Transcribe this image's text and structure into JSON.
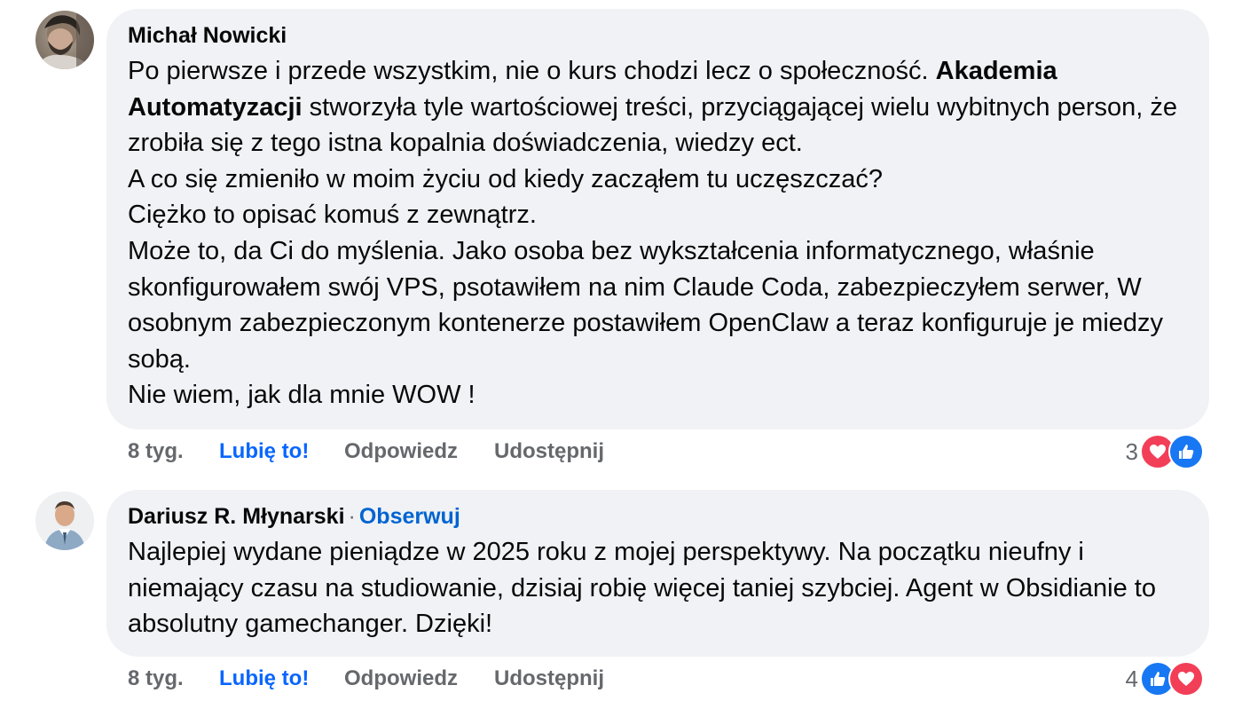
{
  "comments": [
    {
      "author": "Michał Nowicki",
      "avatar": "profile-photo",
      "body_lines": [
        [
          "Po pierwsze i przede wszystkim, nie o kurs chodzi lecz o społeczność. ",
          "Akademia Automatyzacji",
          " stworzyła tyle wartościowej treści, przyciągającej wielu wybitnych person, że zrobiła się z tego istna kopalnia doświadczenia, wiedzy ect."
        ],
        "A co się zmieniło w moim życiu od kiedy zacząłem tu uczęszczać?",
        "Ciężko to opisać komuś z zewnątrz.",
        "Może to, da Ci do myślenia. Jako osoba bez wykształcenia informatycznego, właśnie skonfigurowałem swój VPS, psotawiłem na nim Claude Coda, zabezpieczyłem serwer, W osobnym zabezpieczonym kontenerze postawiłem OpenClaw a teraz konfiguruje je miedzy sobą.",
        "Nie wiem, jak dla mnie WOW !"
      ],
      "bold_phrase": "Akademia Automatyzacji",
      "time": "8 tyg.",
      "like_label": "Lubię to!",
      "reply_label": "Odpowiedz",
      "share_label": "Udostępnij",
      "reaction_count": "3",
      "reaction_icons": [
        "heart-icon",
        "thumbs-up-icon"
      ]
    },
    {
      "author": "Dariusz R. Młynarski",
      "separator": "·",
      "follow_label": "Obserwuj",
      "avatar": "profile-photo",
      "body": "Najlepiej wydane pieniądze w 2025 roku z mojej perspektywy. Na początku nieufny i niemający czasu na studiowanie, dzisiaj robię więcej taniej szybciej. Agent w Obsidianie to absolutny gamechanger. Dzięki!",
      "time": "8 tyg.",
      "like_label": "Lubię to!",
      "reply_label": "Odpowiedz",
      "share_label": "Udostępnij",
      "reaction_count": "4",
      "reaction_icons": [
        "thumbs-up-icon",
        "heart-icon"
      ]
    }
  ],
  "colors": {
    "bubble_bg": "#f0f2f5",
    "text": "#080809",
    "muted": "#65686c",
    "like_active": "#0866ff",
    "follow_link": "#0064d1",
    "reaction_like": "#1877f2",
    "reaction_love": "#f33e58"
  }
}
